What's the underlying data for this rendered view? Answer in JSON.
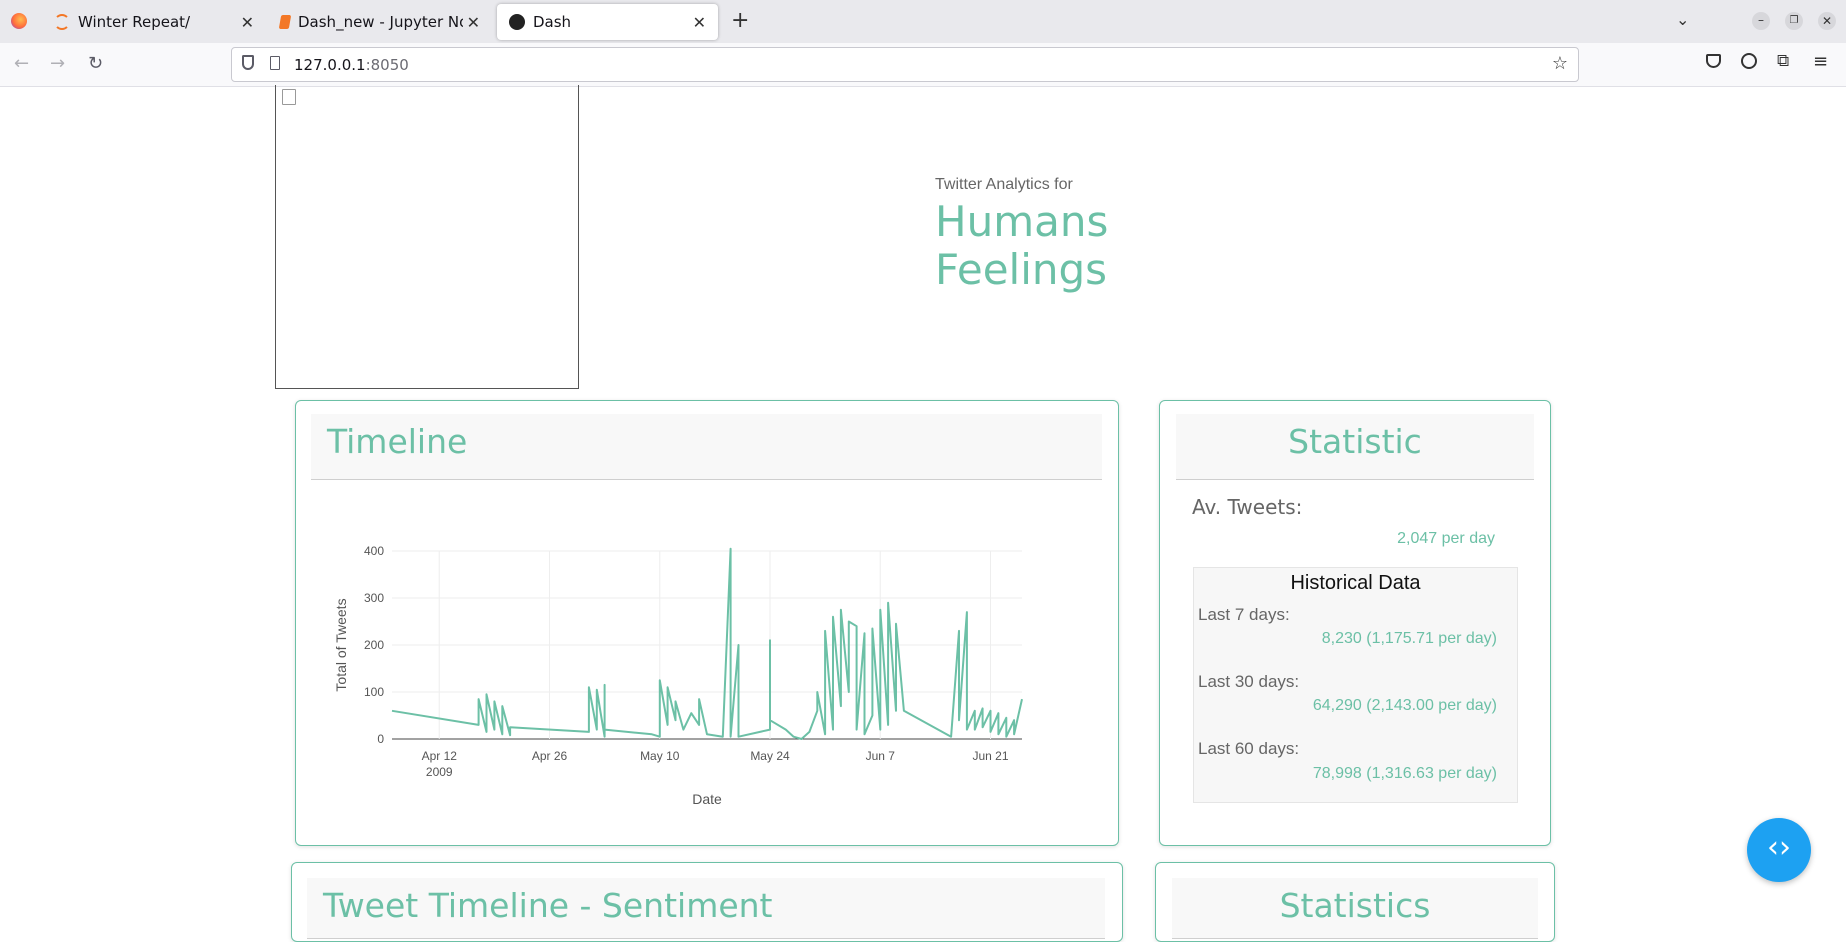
{
  "browser": {
    "tabs": [
      {
        "label": "Winter Repeat/",
        "icon": "jupyter-icon",
        "active": false
      },
      {
        "label": "Dash_new - Jupyter Note",
        "icon": "notebook-icon",
        "active": false
      },
      {
        "label": "Dash",
        "icon": "dash-icon",
        "active": true
      }
    ],
    "url_host": "127.0.0.1",
    "url_port": ":8050",
    "colors": {
      "accent": "#6cc0a6",
      "fab": "#1da1f2"
    }
  },
  "header": {
    "subtitle": "Twitter Analytics for",
    "title_line1": "Humans",
    "title_line2": "Feelings"
  },
  "timeline_card": {
    "title": "Timeline"
  },
  "statistic_card": {
    "title": "Statistic",
    "avg_label": "Av. Tweets:",
    "avg_value": "2,047 per day",
    "historical": {
      "title": "Historical Data",
      "rows": [
        {
          "label": "Last 7 days:",
          "value": "8,230 (1,175.71 per day)"
        },
        {
          "label": "Last 30 days:",
          "value": "64,290 (2,143.00 per day)"
        },
        {
          "label": "Last 60 days:",
          "value": "78,998 (1,316.63 per day)"
        }
      ]
    }
  },
  "bottom_cards": {
    "left_title": "Tweet Timeline - Sentiment",
    "right_title": "Statistics"
  },
  "chart_data": {
    "type": "line",
    "xlabel": "Date",
    "ylabel": "Total of Tweets",
    "ylim": [
      0,
      400
    ],
    "yticks": [
      "0",
      "100",
      "200",
      "300",
      "400"
    ],
    "xticks": [
      "Apr 12",
      "Apr 26",
      "May 10",
      "May 24",
      "Jun 7",
      "Jun 21"
    ],
    "xtick_year": "2009",
    "grid": true,
    "series": [
      {
        "color": "#6cc0a6",
        "points": [
          [
            "2009-04-06",
            60
          ],
          [
            "2009-04-17",
            30
          ],
          [
            "2009-04-17",
            85
          ],
          [
            "2009-04-18",
            15
          ],
          [
            "2009-04-18",
            95
          ],
          [
            "2009-04-19",
            20
          ],
          [
            "2009-04-19",
            80
          ],
          [
            "2009-04-20",
            10
          ],
          [
            "2009-04-20",
            70
          ],
          [
            "2009-04-21",
            8
          ],
          [
            "2009-04-21",
            25
          ],
          [
            "2009-05-01",
            15
          ],
          [
            "2009-05-01",
            110
          ],
          [
            "2009-05-02",
            20
          ],
          [
            "2009-05-02",
            105
          ],
          [
            "2009-05-03",
            5
          ],
          [
            "2009-05-03",
            115
          ],
          [
            "2009-05-03",
            20
          ],
          [
            "2009-05-09",
            10
          ],
          [
            "2009-05-10",
            5
          ],
          [
            "2009-05-10",
            125
          ],
          [
            "2009-05-11",
            30
          ],
          [
            "2009-05-11",
            110
          ],
          [
            "2009-05-12",
            40
          ],
          [
            "2009-05-12",
            80
          ],
          [
            "2009-05-13",
            20
          ],
          [
            "2009-05-14",
            55
          ],
          [
            "2009-05-15",
            30
          ],
          [
            "2009-05-15",
            85
          ],
          [
            "2009-05-16",
            10
          ],
          [
            "2009-05-18",
            5
          ],
          [
            "2009-05-19",
            405
          ],
          [
            "2009-05-19",
            5
          ],
          [
            "2009-05-20",
            200
          ],
          [
            "2009-05-20",
            5
          ],
          [
            "2009-05-24",
            20
          ],
          [
            "2009-05-24",
            210
          ],
          [
            "2009-05-24",
            40
          ],
          [
            "2009-05-26",
            20
          ],
          [
            "2009-05-27",
            5
          ],
          [
            "2009-05-28",
            0
          ],
          [
            "2009-05-29",
            15
          ],
          [
            "2009-05-30",
            60
          ],
          [
            "2009-05-30",
            100
          ],
          [
            "2009-05-31",
            10
          ],
          [
            "2009-05-31",
            230
          ],
          [
            "2009-06-01",
            20
          ],
          [
            "2009-06-01",
            260
          ],
          [
            "2009-06-02",
            70
          ],
          [
            "2009-06-02",
            275
          ],
          [
            "2009-06-03",
            100
          ],
          [
            "2009-06-03",
            250
          ],
          [
            "2009-06-04",
            240
          ],
          [
            "2009-06-04",
            20
          ],
          [
            "2009-06-05",
            225
          ],
          [
            "2009-06-05",
            10
          ],
          [
            "2009-06-06",
            50
          ],
          [
            "2009-06-06",
            235
          ],
          [
            "2009-06-07",
            20
          ],
          [
            "2009-06-07",
            275
          ],
          [
            "2009-06-08",
            30
          ],
          [
            "2009-06-08",
            290
          ],
          [
            "2009-06-09",
            60
          ],
          [
            "2009-06-09",
            230
          ],
          [
            "2009-06-09",
            245
          ],
          [
            "2009-06-10",
            60
          ],
          [
            "2009-06-16",
            5
          ],
          [
            "2009-06-17",
            230
          ],
          [
            "2009-06-17",
            40
          ],
          [
            "2009-06-18",
            270
          ],
          [
            "2009-06-18",
            20
          ],
          [
            "2009-06-19",
            60
          ],
          [
            "2009-06-19",
            20
          ],
          [
            "2009-06-20",
            65
          ],
          [
            "2009-06-20",
            25
          ],
          [
            "2009-06-21",
            60
          ],
          [
            "2009-06-21",
            15
          ],
          [
            "2009-06-22",
            55
          ],
          [
            "2009-06-22",
            10
          ],
          [
            "2009-06-23",
            45
          ],
          [
            "2009-06-23",
            5
          ],
          [
            "2009-06-24",
            40
          ],
          [
            "2009-06-24",
            10
          ],
          [
            "2009-06-25",
            85
          ]
        ]
      }
    ]
  }
}
